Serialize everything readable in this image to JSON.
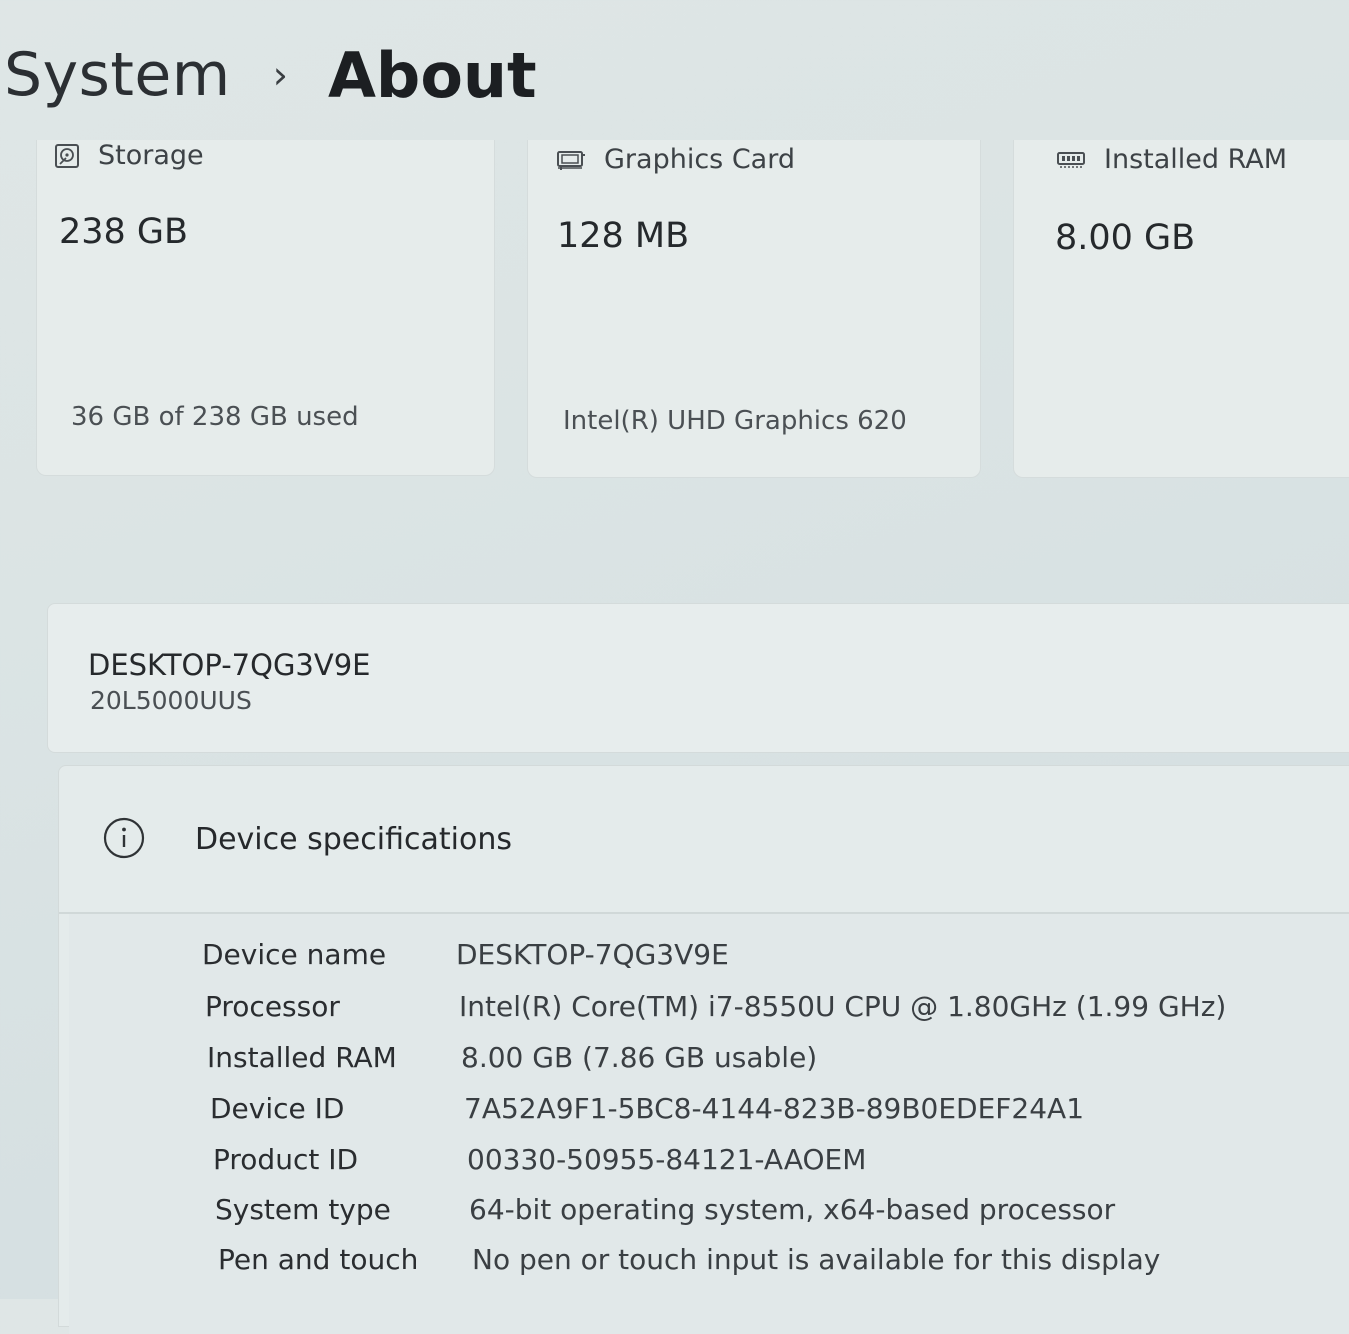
{
  "breadcrumb": {
    "parent": "System",
    "separator": "›",
    "current": "About"
  },
  "cards": {
    "storage": {
      "icon": "storage-icon",
      "label": "Storage",
      "value": "238 GB",
      "detail": "36 GB of 238 GB used"
    },
    "graphics": {
      "icon": "graphics-card-icon",
      "label": "Graphics Card",
      "value": "128 MB",
      "detail": "Intel(R) UHD Graphics 620"
    },
    "ram": {
      "icon": "ram-icon",
      "label": "Installed RAM",
      "value": "8.00 GB"
    }
  },
  "device": {
    "name": "DESKTOP-7QG3V9E",
    "model": "20L5000UUS"
  },
  "specifications": {
    "icon": "info-icon",
    "title": "Device specifications",
    "rows": [
      {
        "label": "Device name",
        "value": "DESKTOP-7QG3V9E"
      },
      {
        "label": "Processor",
        "value": "Intel(R) Core(TM) i7-8550U CPU @ 1.80GHz (1.99 GHz)"
      },
      {
        "label": "Installed RAM",
        "value": "8.00 GB (7.86 GB usable)"
      },
      {
        "label": "Device ID",
        "value": "7A52A9F1-5BC8-4144-823B-89B0EDEF24A1"
      },
      {
        "label": "Product ID",
        "value": "00330-50955-84121-AAOEM"
      },
      {
        "label": "System type",
        "value": "64-bit operating system, x64-based processor"
      },
      {
        "label": "Pen and touch",
        "value": "No pen or touch input is available for this display"
      }
    ]
  }
}
